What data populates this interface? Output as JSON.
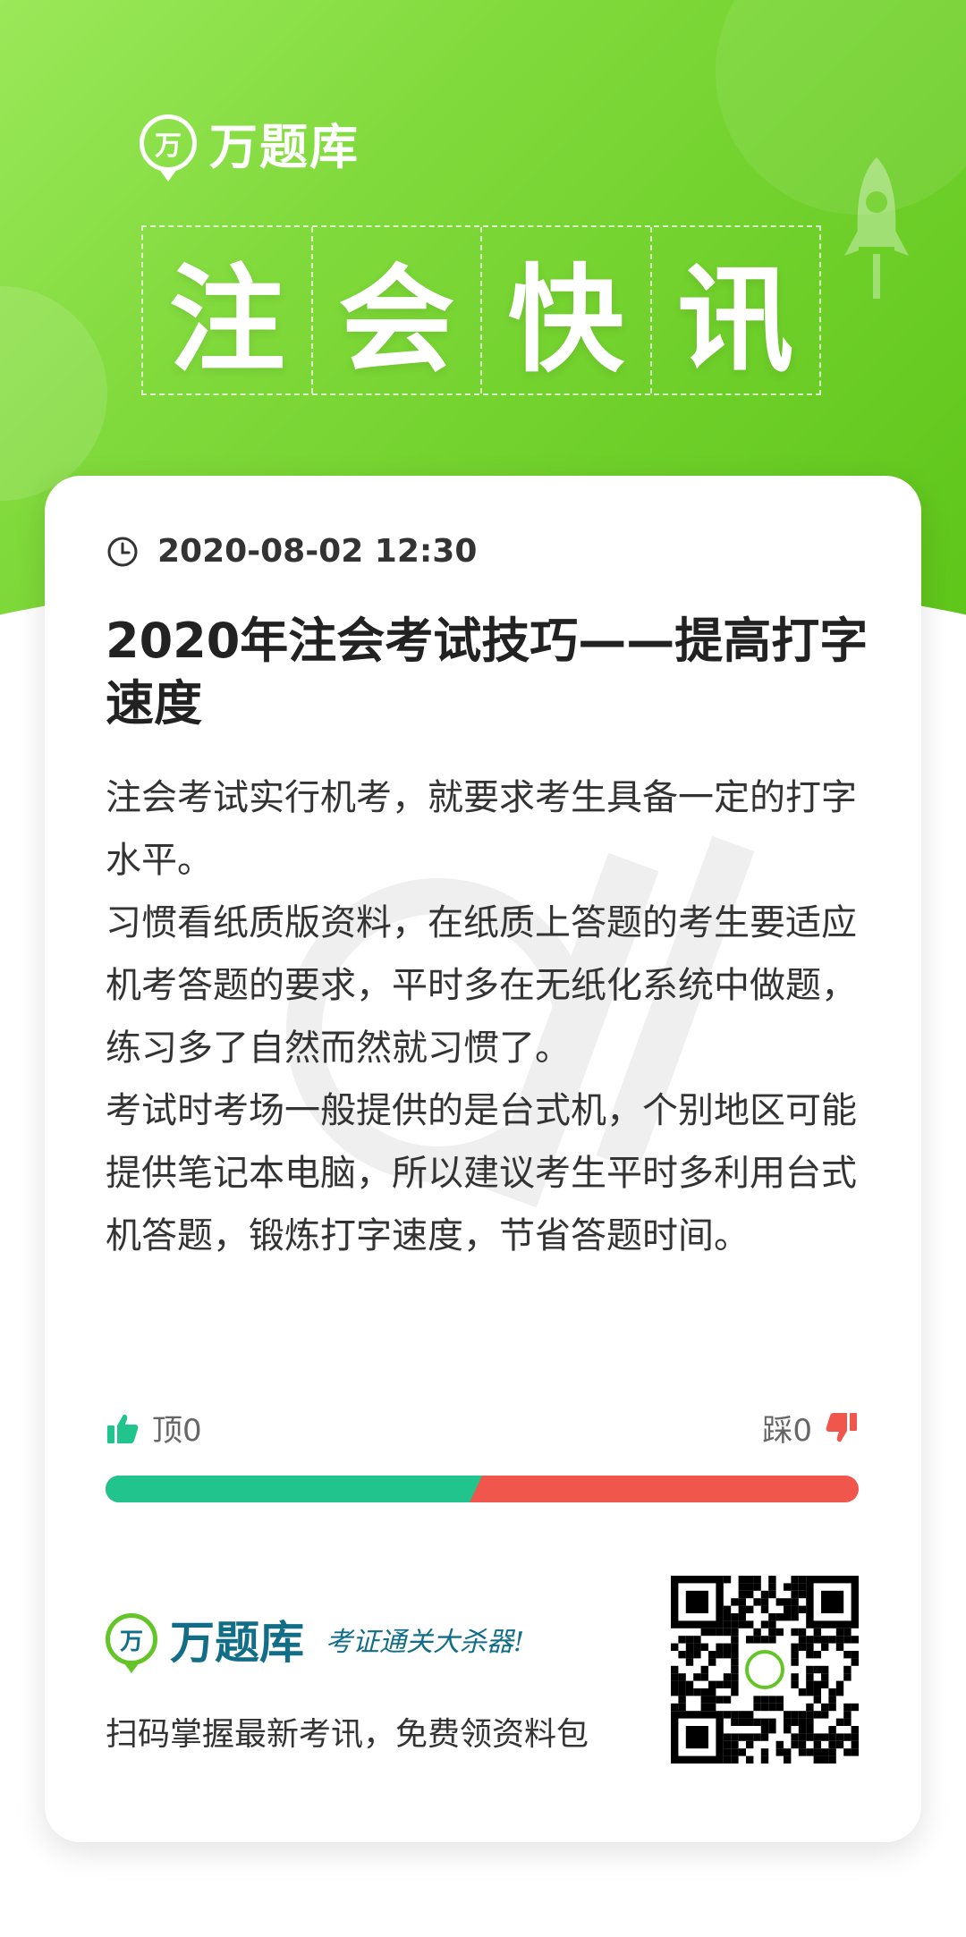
{
  "brand": {
    "logo_glyph": "万",
    "name": "万题库"
  },
  "hero": {
    "title_chars": [
      "注",
      "会",
      "快",
      "讯"
    ]
  },
  "article": {
    "timestamp": "2020-08-02 12:30",
    "title": "2020年注会考试技巧——提高打字速度",
    "paragraphs": [
      "注会考试实行机考，就要求考生具备一定的打字水平。",
      "习惯看纸质版资料，在纸质上答题的考生要适应机考答题的要求，平时多在无纸化系统中做题，练习多了自然而然就习惯了。",
      "考试时考场一般提供的是台式机，个别地区可能提供笔记本电脑，所以建议考生平时多利用台式机答题，锻炼打字速度，节省答题时间。"
    ]
  },
  "votes": {
    "up_label": "顶0",
    "down_label": "踩0",
    "up_share": 0.5,
    "up_color": "#22c48e",
    "down_color": "#f0564b"
  },
  "footer": {
    "badge_glyph": "万",
    "brand": "万题库",
    "slogan": "考证通关大杀器!",
    "cta": "扫码掌握最新考讯，免费领资料包"
  },
  "colors": {
    "hero_green": "#6ccf2a",
    "brand_teal": "#126d86"
  }
}
